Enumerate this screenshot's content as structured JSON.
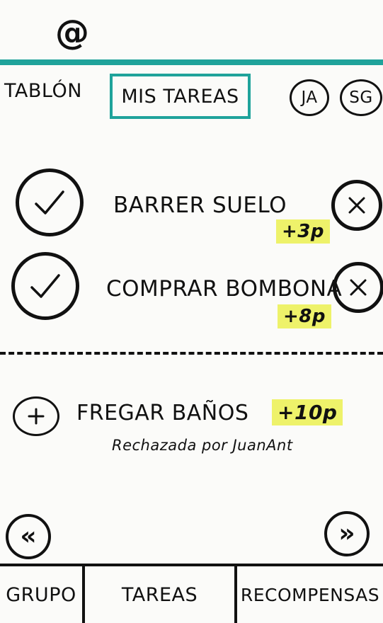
{
  "header": {
    "logo": "@",
    "accent_color": "#1fa39b"
  },
  "tabs": [
    {
      "label": "TABLÓN",
      "active": false
    },
    {
      "label": "MIS TAREAS",
      "active": true
    }
  ],
  "avatars": [
    "JA",
    "SG"
  ],
  "tasks": [
    {
      "title": "BARRER SUELO",
      "points": "+3p",
      "state": "pending",
      "check_icon": "check-icon",
      "remove_icon": "close-icon"
    },
    {
      "title": "COMPRAR BOMBONA",
      "points": "+8p",
      "state": "pending",
      "check_icon": "check-icon",
      "remove_icon": "close-icon"
    }
  ],
  "rejected_tasks": [
    {
      "title": "FREGAR BAÑOS",
      "points": "+10p",
      "note": "Rechazada por JuanAnt",
      "add_icon": "plus-icon"
    }
  ],
  "pager": {
    "prev": "«",
    "next": "»"
  },
  "bottom_nav": [
    "GRUPO",
    "TAREAS",
    "RECOMPENSAS"
  ],
  "highlight_color": "#eef26a"
}
